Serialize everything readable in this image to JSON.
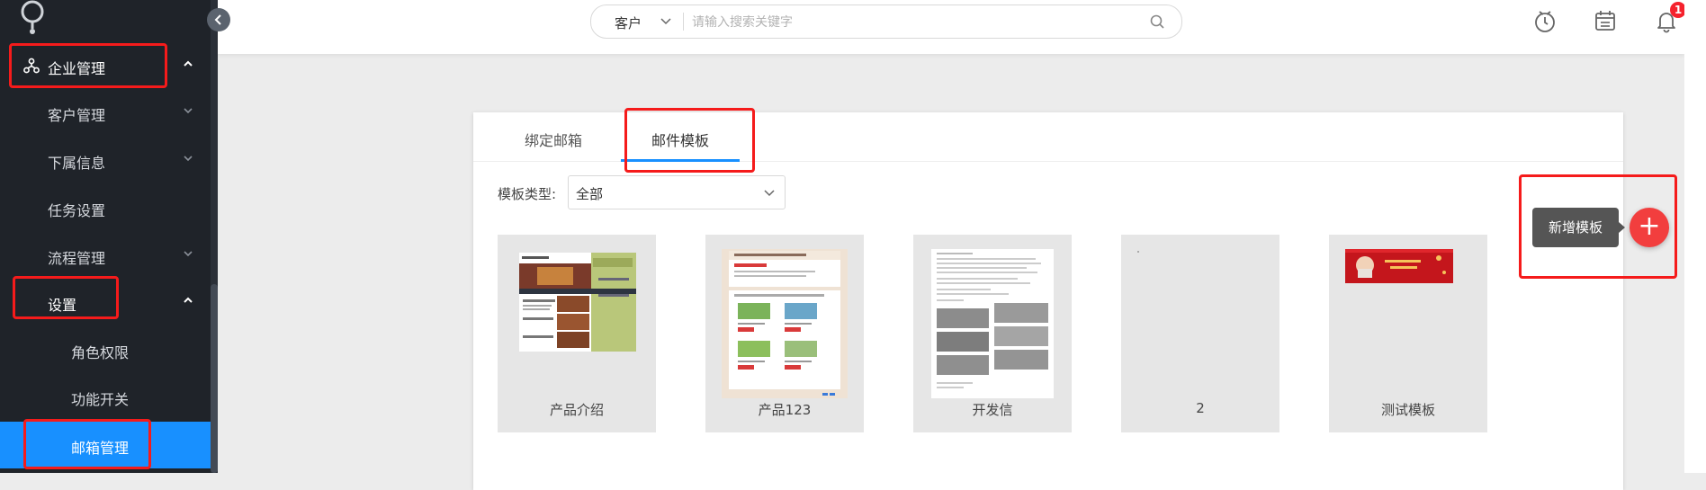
{
  "sidebar": {
    "items": [
      {
        "label": "企业管理"
      },
      {
        "label": "客户管理"
      },
      {
        "label": "下属信息"
      },
      {
        "label": "任务设置"
      },
      {
        "label": "流程管理"
      },
      {
        "label": "设置"
      },
      {
        "label": "角色权限"
      },
      {
        "label": "功能开关"
      },
      {
        "label": "邮箱管理"
      }
    ]
  },
  "header": {
    "search": {
      "scope": "客户",
      "placeholder": "请输入搜索关键字"
    },
    "notification_count": "1"
  },
  "tabs": [
    {
      "label": "绑定邮箱"
    },
    {
      "label": "邮件模板",
      "active": true
    }
  ],
  "filter": {
    "label": "模板类型:",
    "value": "全部"
  },
  "templates": [
    {
      "name": "产品介绍"
    },
    {
      "name": "产品123"
    },
    {
      "name": "开发信"
    },
    {
      "name": "2"
    },
    {
      "name": "测试模板"
    }
  ],
  "add_template": {
    "tooltip": "新增模板",
    "icon": "+"
  },
  "colors": {
    "sidebar_bg": "#1f2329",
    "active": "#1890ff",
    "add_button": "#f23e3e",
    "highlight": "#f51b1b"
  }
}
